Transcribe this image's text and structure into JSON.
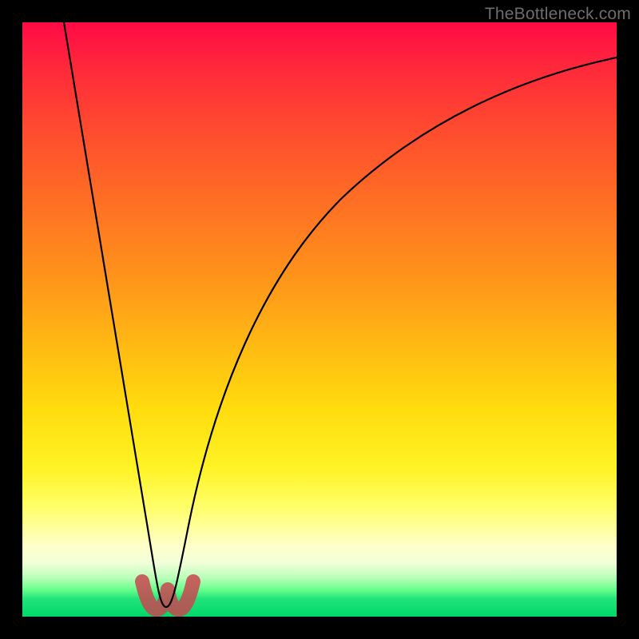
{
  "watermark": "TheBottleneck.com",
  "colors": {
    "background": "#000000",
    "watermark_text": "#6d6d6d",
    "curve_stroke": "#000000",
    "lobe_stroke": "rgba(200,70,80,0.85)",
    "gradient_stops": [
      "#ff0a45",
      "#ff2a3a",
      "#ff4b2f",
      "#ff6e24",
      "#ff911b",
      "#ffb813",
      "#ffdc0e",
      "#fff325",
      "#ffff6e",
      "#ffffc8",
      "#f1ffd8",
      "#b8ffb8",
      "#66ff8c",
      "#22e37a",
      "#00d86a"
    ]
  },
  "chart_data": {
    "type": "line",
    "title": "",
    "xlabel": "",
    "ylabel": "",
    "xlim": [
      0,
      100
    ],
    "ylim": [
      0,
      100
    ],
    "x_optimum": 23,
    "series": [
      {
        "name": "bottleneck-curve",
        "x": [
          5,
          8,
          11,
          14,
          17,
          19,
          21,
          22,
          23,
          24,
          25,
          27,
          30,
          34,
          40,
          48,
          58,
          70,
          84,
          100
        ],
        "y": [
          100,
          84,
          67,
          51,
          35,
          21,
          10,
          4,
          0,
          4,
          10,
          21,
          35,
          48,
          60,
          70,
          78,
          84,
          88,
          90
        ]
      }
    ],
    "annotations": [
      {
        "name": "optimum-lobes",
        "x_range": [
          20,
          26
        ],
        "y_range": [
          0,
          8
        ]
      }
    ]
  }
}
